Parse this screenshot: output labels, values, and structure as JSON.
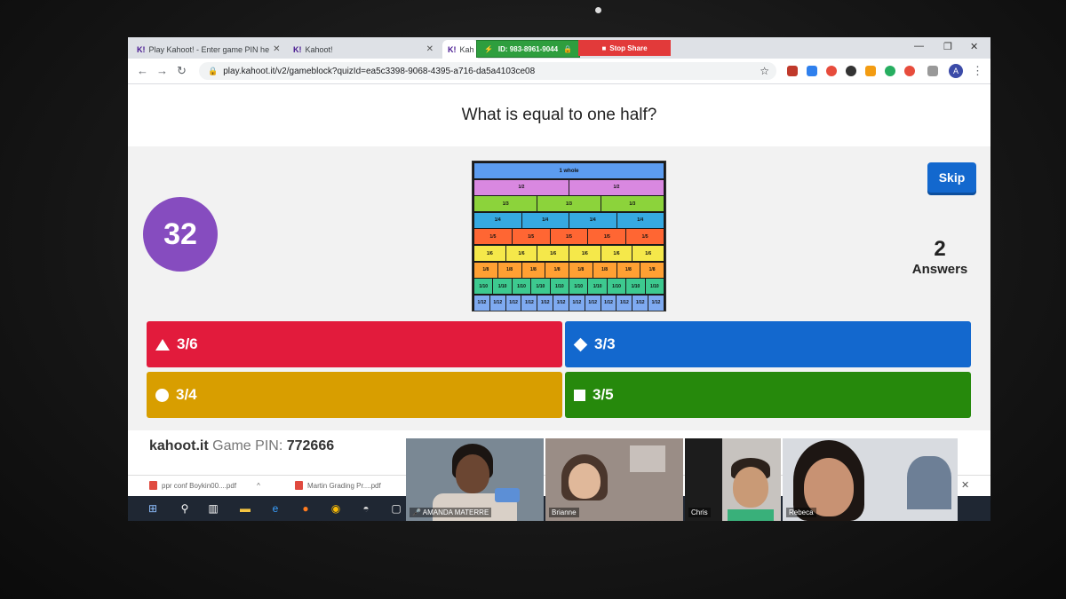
{
  "browser": {
    "tabs": [
      {
        "label": "Play Kahoot! - Enter game PIN he"
      },
      {
        "label": "Kahoot!"
      },
      {
        "label": "Kah"
      }
    ],
    "zoom_meeting_id": "ID: 983-8961-9044",
    "stop_share_label": "Stop Share",
    "url": "play.kahoot.it/v2/gameblock?quizId=ea5c3398-9068-4395-a716-da5a4103ce08",
    "avatar_letter": "A"
  },
  "quiz": {
    "question": "What is equal to one half?",
    "timer": "32",
    "skip_label": "Skip",
    "answer_count": "2",
    "answer_count_label": "Answers",
    "answers": [
      {
        "text": "3/6",
        "shape": "triangle-icon",
        "color": "#e21b3c"
      },
      {
        "text": "3/3",
        "shape": "diamond-icon",
        "color": "#1368ce"
      },
      {
        "text": "3/4",
        "shape": "circle-icon",
        "color": "#d89e00"
      },
      {
        "text": "3/5",
        "shape": "square-icon",
        "color": "#26890c"
      }
    ],
    "fraction_chart": {
      "title": "1 whole",
      "rows": [
        {
          "denominator": "2",
          "color": "#d988e0"
        },
        {
          "denominator": "3",
          "color": "#8cd33b"
        },
        {
          "denominator": "4",
          "color": "#36a9e1"
        },
        {
          "denominator": "5",
          "color": "#ff6633"
        },
        {
          "denominator": "6",
          "color": "#f5e84a"
        },
        {
          "denominator": "8",
          "color": "#ffa033"
        },
        {
          "denominator": "10",
          "color": "#3dc98f"
        },
        {
          "denominator": "12",
          "color": "#7eaaf0"
        }
      ],
      "whole_color": "#5c9cf0"
    }
  },
  "footer": {
    "site": "kahoot.it",
    "game_pin_label": "Game PIN:",
    "game_pin": "772666"
  },
  "downloads": [
    {
      "name": "ppr conf Boykin00....pdf"
    },
    {
      "name": "Martin Grading Pr....pdf"
    }
  ],
  "participants": [
    {
      "name": "AMANDA MATERRE"
    },
    {
      "name": "Brianne"
    },
    {
      "name": "Chris"
    },
    {
      "name": "Rebeca"
    }
  ]
}
